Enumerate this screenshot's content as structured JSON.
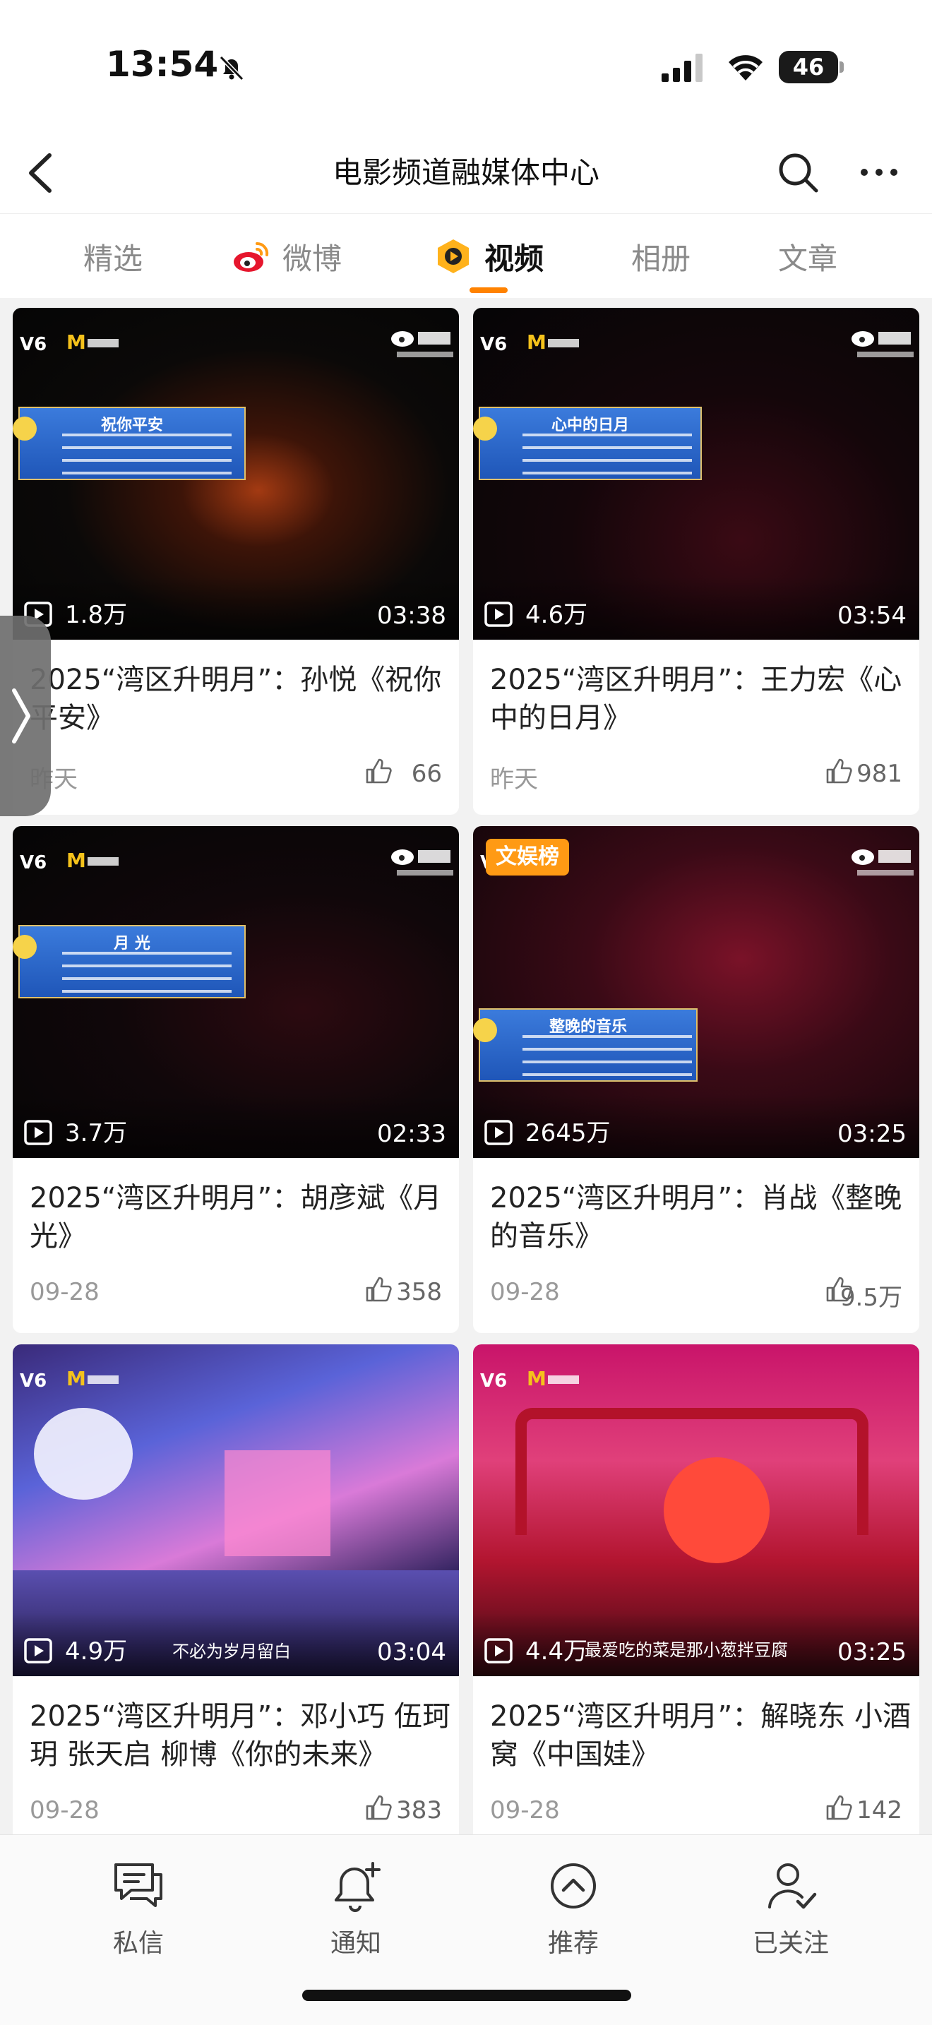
{
  "status_bar": {
    "time": "13:54",
    "battery": "46"
  },
  "header": {
    "title": "电影频道融媒体中心"
  },
  "tabs": [
    {
      "label": "精选",
      "active": false
    },
    {
      "label": "微博",
      "active": false
    },
    {
      "label": "视频",
      "active": true
    },
    {
      "label": "相册",
      "active": false
    },
    {
      "label": "文章",
      "active": false
    }
  ],
  "videos": [
    {
      "title": "2025“湾区升明月”：孙悦《祝你平安》",
      "plays": "1.8万",
      "duration": "03:38",
      "date": "昨天",
      "likes": "66",
      "caption": "祝你平安"
    },
    {
      "title": "2025“湾区升明月”：王力宏《心中的日月》",
      "plays": "4.6万",
      "duration": "03:54",
      "date": "昨天",
      "likes": "981",
      "caption": "心中的日月"
    },
    {
      "title": "2025“湾区升明月”：胡彦斌《月光》",
      "plays": "3.7万",
      "duration": "02:33",
      "date": "09-28",
      "likes": "358",
      "caption": "月 光"
    },
    {
      "title": "2025“湾区升明月”：肖战《整晚的音乐》",
      "plays": "2645万",
      "duration": "03:25",
      "date": "09-28",
      "likes": "9.5万",
      "caption": "整晚的音乐",
      "tag": "文娱榜"
    },
    {
      "title": "2025“湾区升明月”：邓小巧 伍珂玥 张天启 柳博《你的未来》",
      "plays": "4.9万",
      "duration": "03:04",
      "date": "09-28",
      "likes": "383",
      "subtitle": "不必为岁月留白"
    },
    {
      "title": "2025“湾区升明月”：解晓东 小酒窝《中国娃》",
      "plays": "4.4万",
      "duration": "03:25",
      "date": "09-28",
      "likes": "142",
      "subtitle": "最爱吃的菜是那小葱拌豆腐"
    }
  ],
  "bottom_nav": [
    {
      "label": "私信",
      "icon": "message-icon"
    },
    {
      "label": "通知",
      "icon": "bell-plus-icon"
    },
    {
      "label": "推荐",
      "icon": "compass-up-icon"
    },
    {
      "label": "已关注",
      "icon": "user-check-icon"
    }
  ],
  "colors": {
    "accent": "#ff8200",
    "badge": "#ff9a14"
  }
}
